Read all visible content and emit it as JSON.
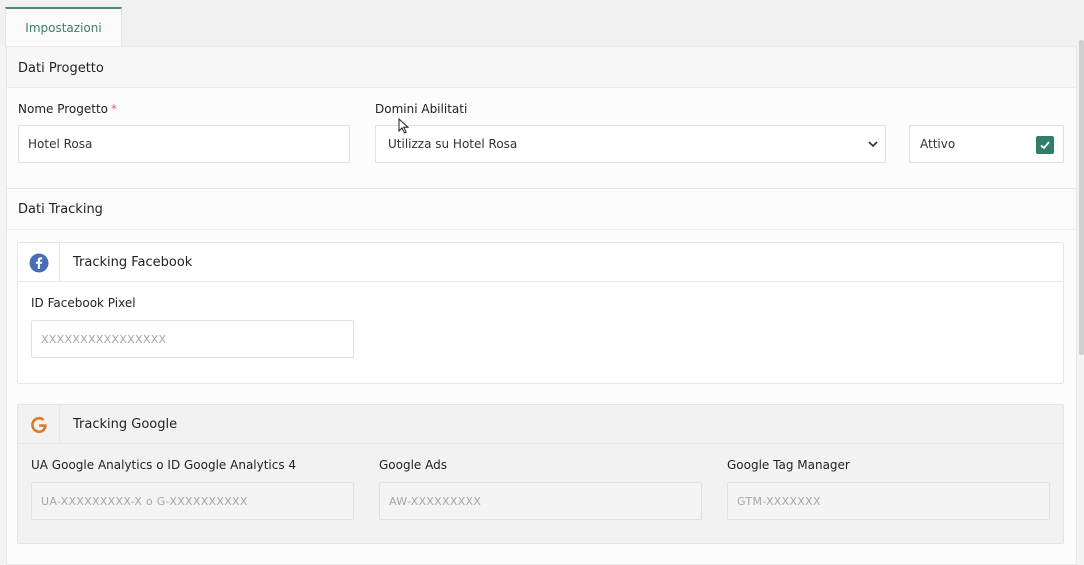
{
  "tabs": [
    {
      "label": "Impostazioni"
    }
  ],
  "project_section": {
    "title": "Dati Progetto",
    "name_label": "Nome Progetto",
    "required_mark": "*",
    "name_value": "Hotel Rosa",
    "domains_label": "Domini Abilitati",
    "domains_value": "Utilizza su Hotel Rosa",
    "active_label": "Attivo",
    "active_checked": true
  },
  "tracking_section": {
    "title": "Dati Tracking",
    "facebook": {
      "title": "Tracking Facebook",
      "icon": "facebook-icon",
      "pixel_label": "ID Facebook Pixel",
      "pixel_placeholder": "XXXXXXXXXXXXXXXX"
    },
    "google": {
      "title": "Tracking Google",
      "icon": "google-icon",
      "analytics_label": "UA Google Analytics o ID Google Analytics 4",
      "analytics_placeholder": "UA-XXXXXXXXX-X o G-XXXXXXXXXX",
      "ads_label": "Google Ads",
      "ads_placeholder": "AW-XXXXXXXXX",
      "gtm_label": "Google Tag Manager",
      "gtm_placeholder": "GTM-XXXXXXX"
    }
  },
  "colors": {
    "accent": "#2f7d6a",
    "facebook": "#4a6eb5",
    "google": "#e07b2a"
  }
}
